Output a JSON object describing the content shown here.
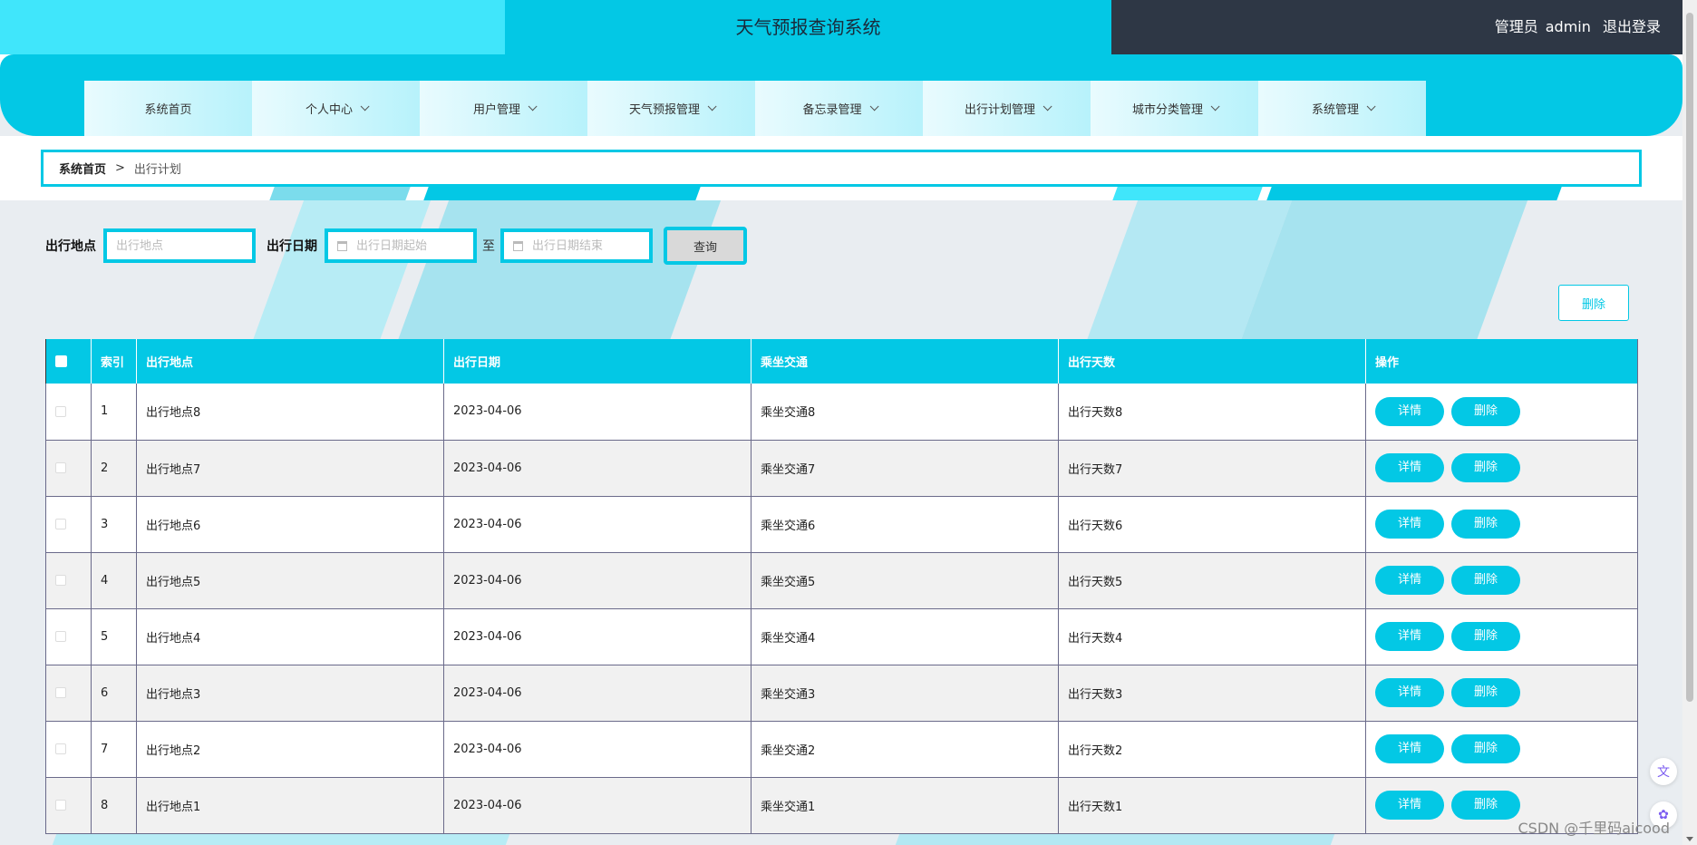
{
  "header": {
    "title": "天气预报查询系统",
    "user_role": "管理员",
    "username": "admin",
    "logout_label": "退出登录"
  },
  "nav": {
    "items": [
      {
        "label": "系统首页",
        "has_dropdown": false
      },
      {
        "label": "个人中心",
        "has_dropdown": true
      },
      {
        "label": "用户管理",
        "has_dropdown": true
      },
      {
        "label": "天气预报管理",
        "has_dropdown": true
      },
      {
        "label": "备忘录管理",
        "has_dropdown": true
      },
      {
        "label": "出行计划管理",
        "has_dropdown": true
      },
      {
        "label": "城市分类管理",
        "has_dropdown": true
      },
      {
        "label": "系统管理",
        "has_dropdown": true
      }
    ]
  },
  "breadcrumb": {
    "home": "系统首页",
    "separator": ">",
    "current": "出行计划"
  },
  "search": {
    "location_label": "出行地点",
    "location_placeholder": "出行地点",
    "date_label": "出行日期",
    "date_start_placeholder": "出行日期起始",
    "date_to": "至",
    "date_end_placeholder": "出行日期结束",
    "query_label": "查询"
  },
  "toolbar": {
    "delete_label": "删除"
  },
  "table": {
    "columns": [
      "",
      "索引",
      "出行地点",
      "出行日期",
      "乘坐交通",
      "出行天数",
      "操作"
    ],
    "detail_label": "详情",
    "delete_label": "删除",
    "rows": [
      {
        "index": "1",
        "location": "出行地点8",
        "date": "2023-04-06",
        "transport": "乘坐交通8",
        "days": "出行天数8"
      },
      {
        "index": "2",
        "location": "出行地点7",
        "date": "2023-04-06",
        "transport": "乘坐交通7",
        "days": "出行天数7"
      },
      {
        "index": "3",
        "location": "出行地点6",
        "date": "2023-04-06",
        "transport": "乘坐交通6",
        "days": "出行天数6"
      },
      {
        "index": "4",
        "location": "出行地点5",
        "date": "2023-04-06",
        "transport": "乘坐交通5",
        "days": "出行天数5"
      },
      {
        "index": "5",
        "location": "出行地点4",
        "date": "2023-04-06",
        "transport": "乘坐交通4",
        "days": "出行天数4"
      },
      {
        "index": "6",
        "location": "出行地点3",
        "date": "2023-04-06",
        "transport": "乘坐交通3",
        "days": "出行天数3"
      },
      {
        "index": "7",
        "location": "出行地点2",
        "date": "2023-04-06",
        "transport": "乘坐交通2",
        "days": "出行天数2"
      },
      {
        "index": "8",
        "location": "出行地点1",
        "date": "2023-04-06",
        "transport": "乘坐交通1",
        "days": "出行天数1"
      }
    ]
  },
  "watermark": "CSDN @千里码aicood",
  "colors": {
    "accent": "#03c8e5",
    "accent_light": "#40e6fb",
    "header_dark": "#2e3745",
    "page_bg": "#e9edf1"
  }
}
